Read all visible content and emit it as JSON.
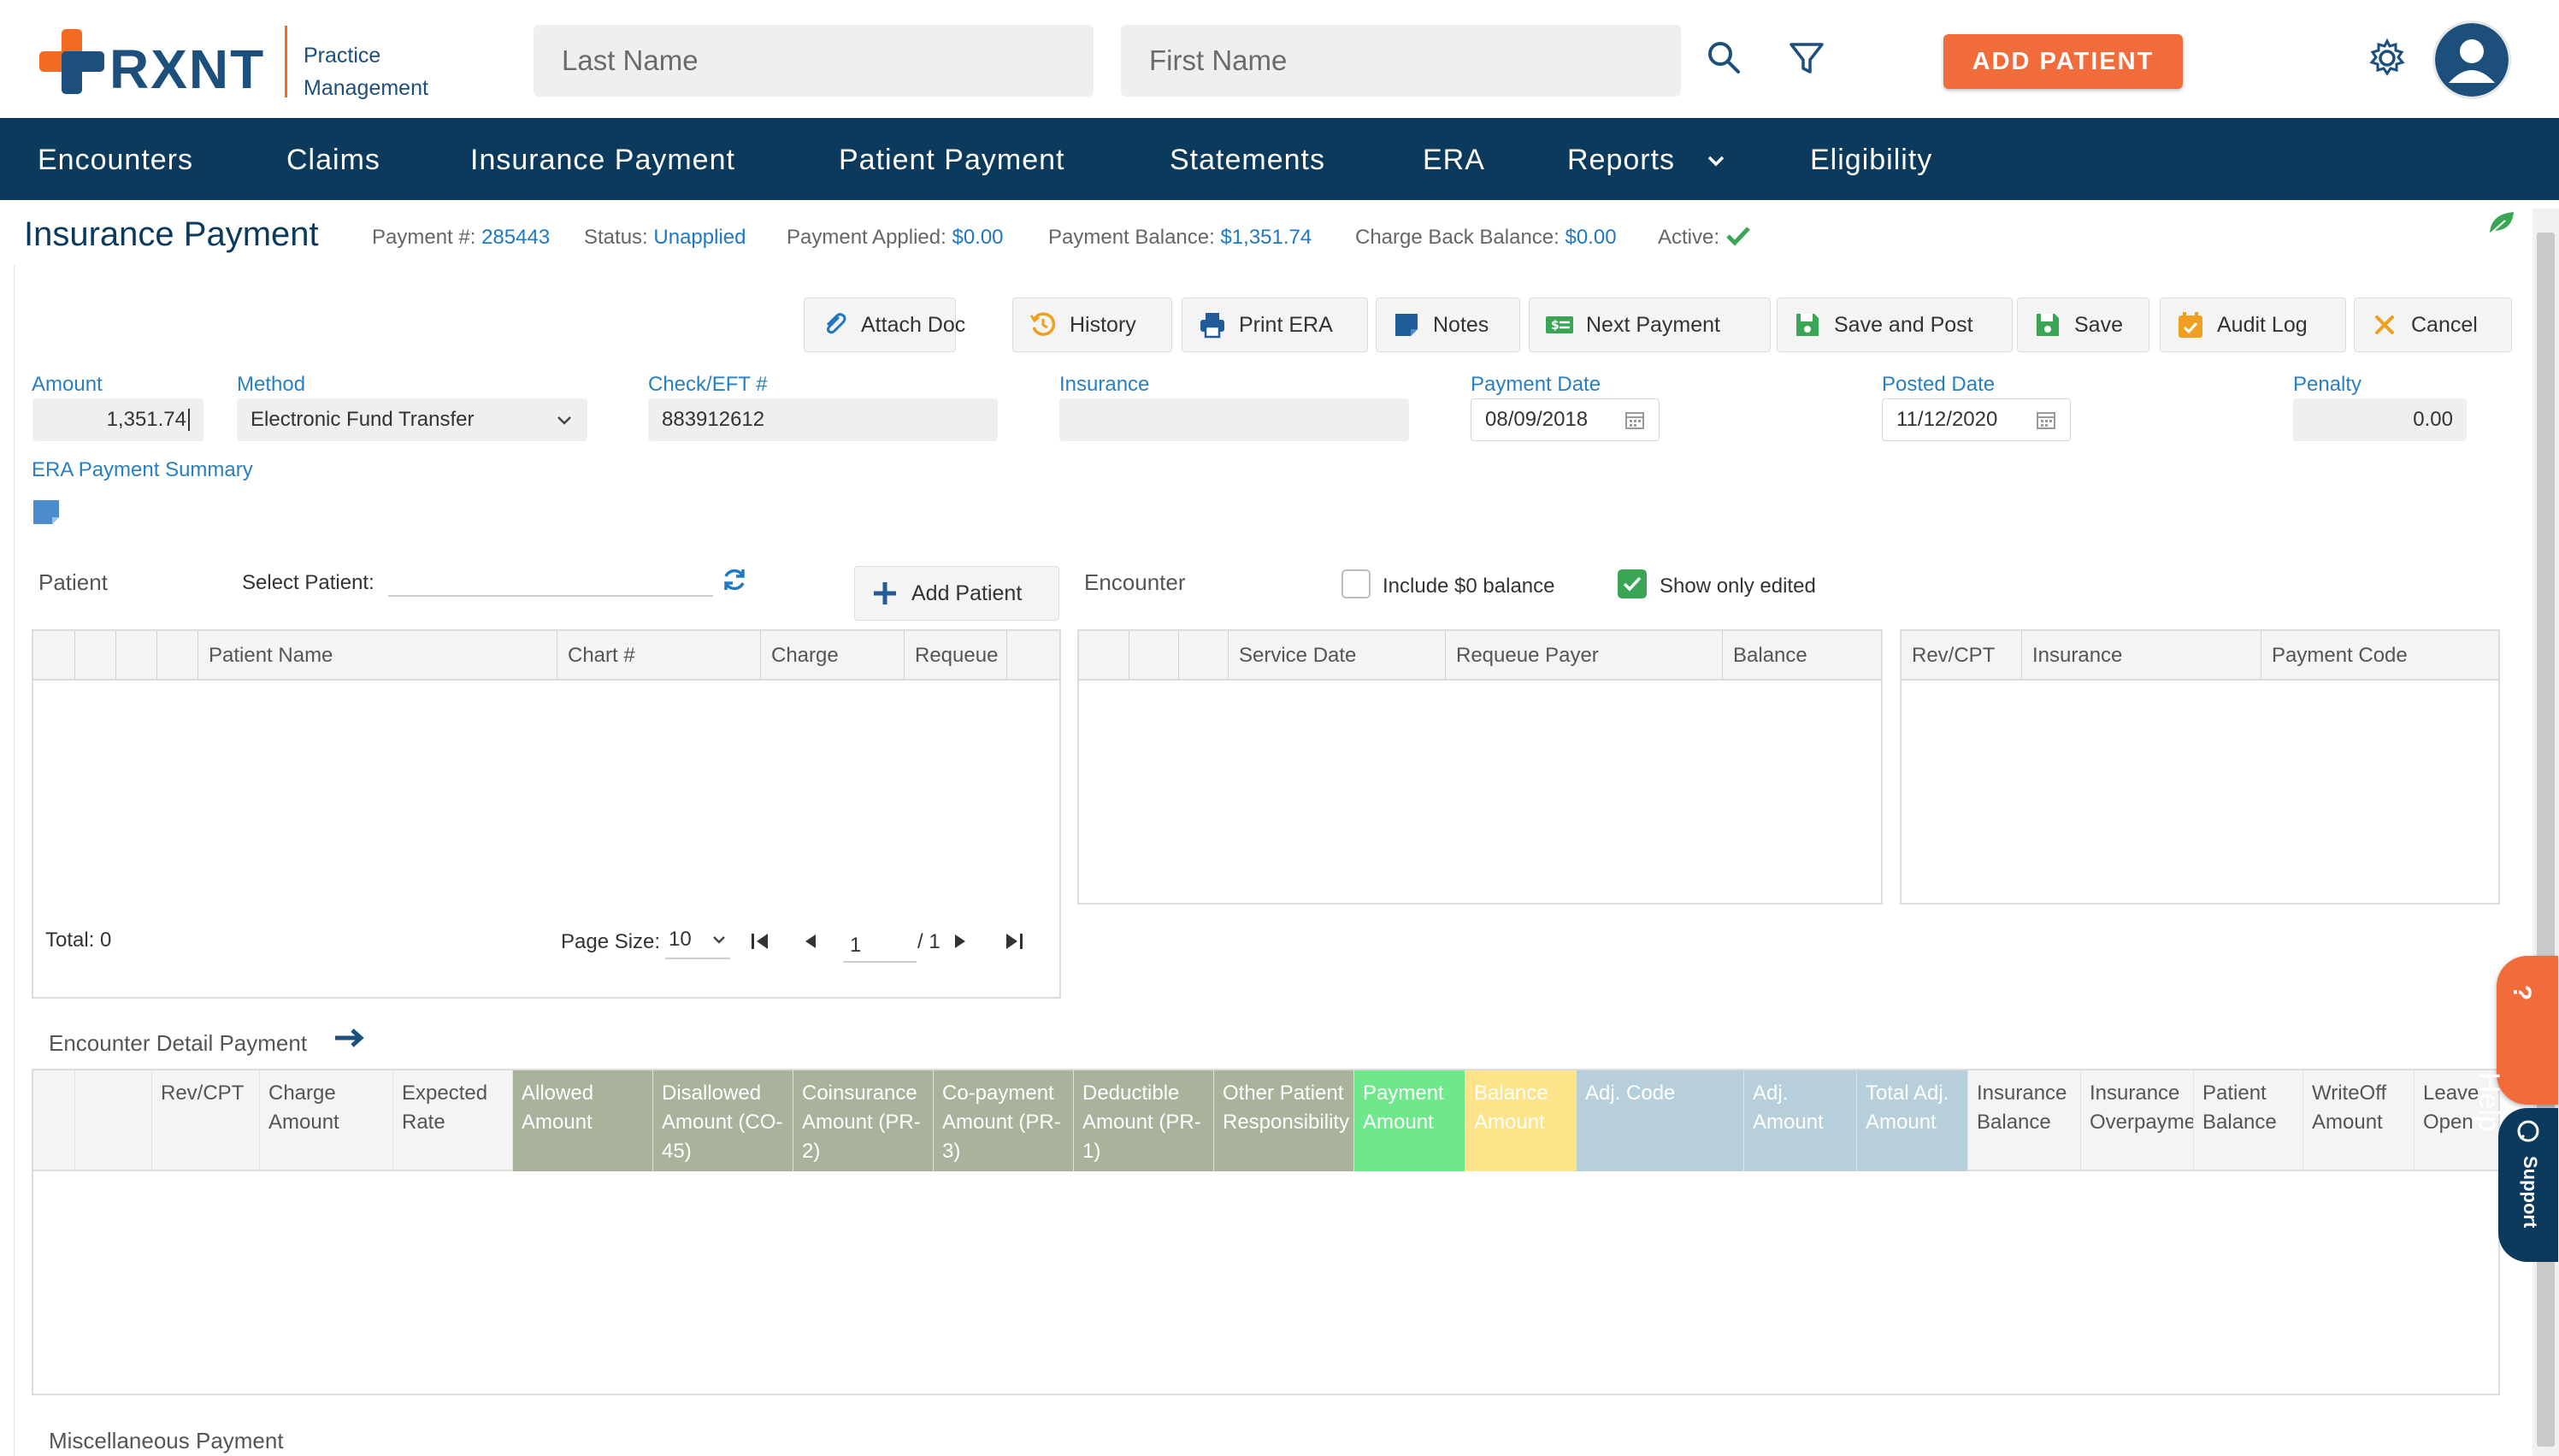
{
  "header": {
    "logo_text": "RXNT",
    "logo_sub1": "Practice",
    "logo_sub2": "Management",
    "last_name_placeholder": "Last Name",
    "first_name_placeholder": "First Name",
    "add_patient": "ADD PATIENT",
    "brand_color": "#1d4f7c",
    "accent_color": "#f26b21"
  },
  "nav": {
    "items": [
      "Encounters",
      "Claims",
      "Insurance Payment",
      "Patient Payment",
      "Statements",
      "ERA",
      "Reports",
      "Eligibility"
    ],
    "background": "#0b3a5c"
  },
  "page": {
    "title": "Insurance Payment",
    "payment_no_label": "Payment #:",
    "payment_no": "285443",
    "status_label": "Status:",
    "status": "Unapplied",
    "applied_label": "Payment Applied:",
    "applied": "$0.00",
    "balance_label": "Payment Balance:",
    "balance": "$1,351.74",
    "chargeback_label": "Charge Back Balance:",
    "chargeback": "$0.00",
    "active_label": "Active:"
  },
  "toolbar": {
    "attach_doc": "Attach Doc",
    "history": "History",
    "print_era": "Print ERA",
    "notes": "Notes",
    "next_payment": "Next Payment",
    "save_and_post": "Save and Post",
    "save": "Save",
    "audit_log": "Audit Log",
    "cancel": "Cancel"
  },
  "form": {
    "amount_label": "Amount",
    "amount": "1,351.74",
    "method_label": "Method",
    "method": "Electronic Fund Transfer",
    "check_label": "Check/EFT #",
    "check": "883912612",
    "insurance_label": "Insurance",
    "insurance": "",
    "payment_date_label": "Payment Date",
    "payment_date": "08/09/2018",
    "posted_date_label": "Posted Date",
    "posted_date": "11/12/2020",
    "penalty_label": "Penalty",
    "penalty": "0.00",
    "era_summary_label": "ERA Payment Summary"
  },
  "patient_section": {
    "label": "Patient",
    "select_label": "Select Patient:",
    "add_patient": "Add Patient",
    "columns": [
      "Patient Name",
      "Chart #",
      "Charge",
      "Requeue"
    ],
    "total": "Total: 0",
    "page_size_label": "Page Size:",
    "page_size": "10",
    "page": "1",
    "page_total": "/ 1"
  },
  "encounter_section": {
    "label": "Encounter",
    "include_zero": "Include $0 balance",
    "show_edited": "Show only edited",
    "include_zero_checked": false,
    "show_edited_checked": true,
    "columns": [
      "Service Date",
      "Requeue Payer",
      "Balance"
    ],
    "right_columns": [
      "Rev/CPT",
      "Insurance",
      "Payment Code"
    ]
  },
  "encounter_detail": {
    "label": "Encounter Detail Payment",
    "columns": [
      {
        "text": "Rev/CPT",
        "color": "none"
      },
      {
        "text": "Charge Amount",
        "color": "none"
      },
      {
        "text": "Expected Rate",
        "color": "none"
      },
      {
        "text": "Allowed Amount",
        "color": "olive"
      },
      {
        "text": "Disallowed Amount (CO-45)",
        "color": "olive"
      },
      {
        "text": "Coinsurance Amount (PR-2)",
        "color": "olive"
      },
      {
        "text": "Co-payment Amount (PR-3)",
        "color": "olive"
      },
      {
        "text": "Deductible Amount (PR-1)",
        "color": "olive"
      },
      {
        "text": "Other Patient Responsibility",
        "color": "olive"
      },
      {
        "text": "Payment Amount",
        "color": "green"
      },
      {
        "text": "Balance Amount",
        "color": "yellow"
      },
      {
        "text": "Adj. Code",
        "color": "blue"
      },
      {
        "text": "Adj. Amount",
        "color": "blue"
      },
      {
        "text": "Total Adj. Amount",
        "color": "blue"
      },
      {
        "text": "Insurance Balance",
        "color": "none"
      },
      {
        "text": "Insurance Overpayment",
        "color": "none"
      },
      {
        "text": "Patient Balance",
        "color": "none"
      },
      {
        "text": "WriteOff Amount",
        "color": "none"
      },
      {
        "text": "Leave Open",
        "color": "none"
      }
    ]
  },
  "misc": {
    "label": "Miscellaneous Payment"
  },
  "side_tabs": {
    "help": "Help",
    "support": "Support"
  }
}
